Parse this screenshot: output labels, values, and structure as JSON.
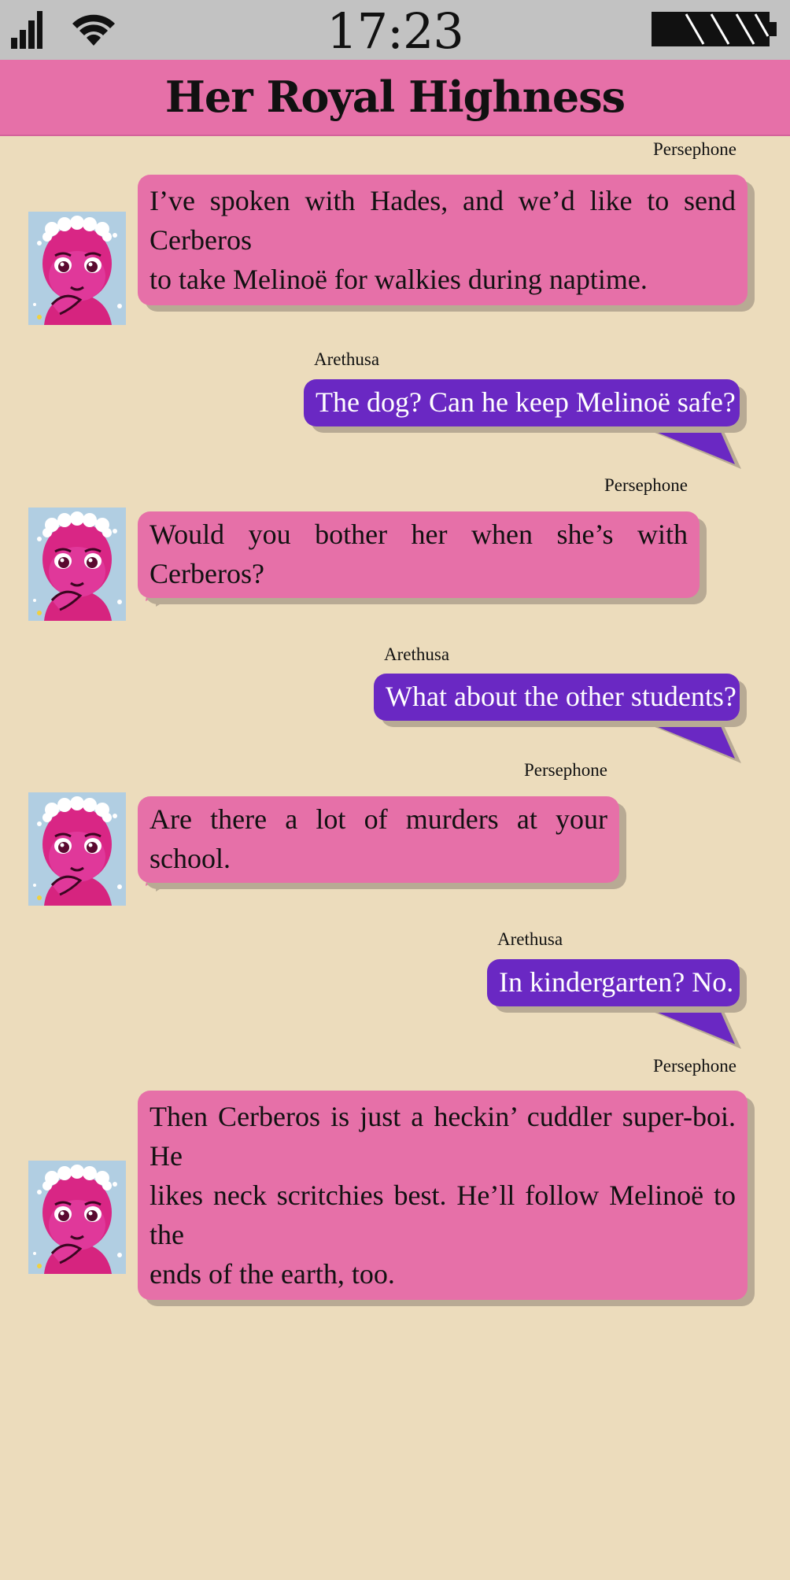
{
  "status_bar": {
    "time": "17:23",
    "signal_icon": "cellular-signal-icon",
    "wifi_icon": "wifi-icon",
    "battery_icon": "battery-icon"
  },
  "header": {
    "title": "Her Royal Highness"
  },
  "colors": {
    "incoming_bubble": "#e670a8",
    "outgoing_bubble": "#6a28c3",
    "background": "#ecdcbc",
    "header": "#e670a8",
    "status_bar": "#c2c2c2"
  },
  "messages": [
    {
      "sender": "Persephone",
      "direction": "incoming",
      "lines": [
        "I’ve spoken with Hades, and we’d like to send Cerberos",
        "to take Melinoë for walkies during naptime."
      ]
    },
    {
      "sender": "Arethusa",
      "direction": "outgoing",
      "lines": [
        "The dog? Can he keep Melinoë safe?"
      ]
    },
    {
      "sender": "Persephone",
      "direction": "incoming",
      "lines": [
        "Would you bother her when she’s with Cerberos?"
      ]
    },
    {
      "sender": "Arethusa",
      "direction": "outgoing",
      "lines": [
        "What about the other students?"
      ]
    },
    {
      "sender": "Persephone",
      "direction": "incoming",
      "lines": [
        "Are there a lot of murders at your school."
      ]
    },
    {
      "sender": "Arethusa",
      "direction": "outgoing",
      "lines": [
        "In kindergarten? No."
      ]
    },
    {
      "sender": "Persephone",
      "direction": "incoming",
      "lines": [
        "Then Cerberos is just a heckin’ cuddler super-boi. He",
        "likes neck scritchies best. He’ll follow Melinoë to the",
        "ends of the earth, too."
      ]
    }
  ]
}
